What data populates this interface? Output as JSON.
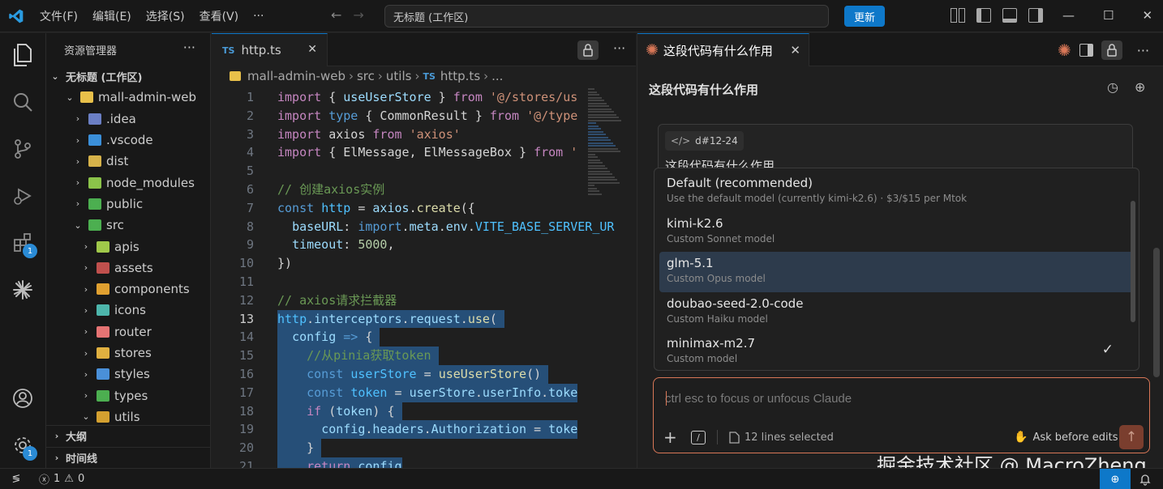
{
  "titlebar": {
    "menus": [
      "文件(F)",
      "编辑(E)",
      "选择(S)",
      "查看(V)",
      "···"
    ],
    "search_text": "无标题 (工作区)",
    "update_label": "更新"
  },
  "activity": {
    "extensions_badge": "1",
    "settings_badge": "1"
  },
  "sidebar": {
    "title": "资源管理器",
    "workspace": "无标题 (工作区)",
    "items": [
      {
        "label": "mall-admin-web",
        "indent": 1,
        "open": true,
        "color": "#e8c04a"
      },
      {
        "label": ".idea",
        "indent": 2,
        "open": false,
        "color": "#6b7fc4"
      },
      {
        "label": ".vscode",
        "indent": 2,
        "open": false,
        "color": "#3b8fd9"
      },
      {
        "label": "dist",
        "indent": 2,
        "open": false,
        "color": "#d6b24a"
      },
      {
        "label": "node_modules",
        "indent": 2,
        "open": false,
        "color": "#8bc34a"
      },
      {
        "label": "public",
        "indent": 2,
        "open": false,
        "color": "#4caf50"
      },
      {
        "label": "src",
        "indent": 2,
        "open": true,
        "color": "#4caf50"
      },
      {
        "label": "apis",
        "indent": 3,
        "open": false,
        "color": "#a0c84a"
      },
      {
        "label": "assets",
        "indent": 3,
        "open": false,
        "color": "#c0504d"
      },
      {
        "label": "components",
        "indent": 3,
        "open": false,
        "color": "#e0a030"
      },
      {
        "label": "icons",
        "indent": 3,
        "open": false,
        "color": "#4db6ac"
      },
      {
        "label": "router",
        "indent": 3,
        "open": false,
        "color": "#e57373"
      },
      {
        "label": "stores",
        "indent": 3,
        "open": false,
        "color": "#e0b040"
      },
      {
        "label": "styles",
        "indent": 3,
        "open": false,
        "color": "#4a90d9"
      },
      {
        "label": "types",
        "indent": 3,
        "open": false,
        "color": "#4caf50"
      },
      {
        "label": "utils",
        "indent": 3,
        "open": true,
        "color": "#d4a030"
      }
    ],
    "outline": "大纲",
    "timeline": "时间线"
  },
  "editor": {
    "tab_label": "http.ts",
    "tab_lang": "TS",
    "breadcrumb": [
      "mall-admin-web",
      "src",
      "utils",
      "http.ts",
      "..."
    ],
    "current_line": 13
  },
  "panel": {
    "tab_label": "这段代码有什么作用",
    "conversation_title": "这段代码有什么作用",
    "context_chip": "d#12-24",
    "message_text": "这段代码有什么作用",
    "models": [
      {
        "name": "Default (recommended)",
        "desc": "Use the default model (currently kimi-k2.6) · $3/$15 per Mtok",
        "highlighted": false,
        "checked": false
      },
      {
        "name": "kimi-k2.6",
        "desc": "Custom Sonnet model",
        "highlighted": false,
        "checked": false
      },
      {
        "name": "glm-5.1",
        "desc": "Custom Opus model",
        "highlighted": true,
        "checked": false
      },
      {
        "name": "doubao-seed-2.0-code",
        "desc": "Custom Haiku model",
        "highlighted": false,
        "checked": false
      },
      {
        "name": "minimax-m2.7",
        "desc": "Custom model",
        "highlighted": false,
        "checked": true
      }
    ],
    "input_placeholder": "ctrl esc to focus or unfocus Claude",
    "lines_selected": "12 lines selected",
    "ask_mode": "Ask before edits"
  },
  "watermark": "掘金技术社区 @ MacroZheng",
  "status": {
    "errors": "1",
    "warnings": "0"
  },
  "colors": {
    "accent": "#0e78c9",
    "claude": "#d97757",
    "selection": "#264f78"
  }
}
